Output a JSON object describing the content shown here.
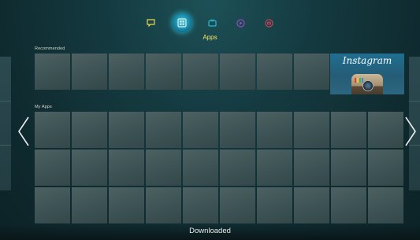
{
  "nav": {
    "items": [
      {
        "icon": "chat-bubble-icon",
        "color": "#e7d84a"
      },
      {
        "icon": "apps-icon",
        "color": "#e7ecea",
        "active": true
      },
      {
        "icon": "tv-icon",
        "color": "#2bb7d4"
      },
      {
        "icon": "play-icon",
        "color": "#9b4cc4"
      },
      {
        "icon": "camera-icon",
        "color": "#d6405a"
      }
    ],
    "active_label": "Apps"
  },
  "sections": {
    "recommended": "Recommended",
    "my_apps": "My Apps"
  },
  "recommended_featured": {
    "name": "Instagram"
  },
  "footer": {
    "label": "Downloaded"
  },
  "colors": {
    "accent_label": "#f2e566",
    "tile": "#405556",
    "background": "#143a40"
  }
}
